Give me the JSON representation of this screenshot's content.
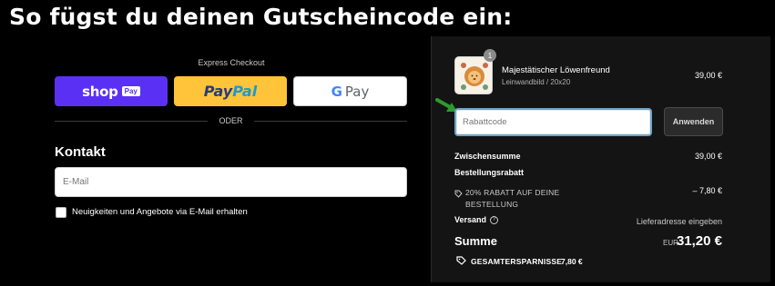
{
  "headline": "So fügst du deinen Gutscheincode ein:",
  "checkout": {
    "express_label": "Express Checkout",
    "shop_pay": {
      "brand": "shop",
      "badge": "Pay"
    },
    "paypal": {
      "part1": "Pay",
      "part2": "Pal"
    },
    "google_pay": {
      "g": "G",
      "label": "Pay"
    },
    "divider": "ODER",
    "contact_heading": "Kontakt",
    "email_placeholder": "E-Mail",
    "newsletter_label": "Neuigkeiten und Angebote via E-Mail erhalten"
  },
  "summary": {
    "product": {
      "name": "Majestätischer Löwenfreund",
      "variant": "Leinwandbild / 20x20",
      "price": "39,00 €",
      "quantity": "1"
    },
    "discount_placeholder": "Rabattcode",
    "apply_label": "Anwenden",
    "subtotal_label": "Zwischensumme",
    "subtotal_value": "39,00 €",
    "order_discount_label": "Bestellungsrabatt",
    "promo_text": "20% RABATT AUF DEINE BESTELLUNG",
    "promo_value": "– 7,80 €",
    "shipping_label": "Versand",
    "shipping_value": "Lieferadresse eingeben",
    "total_label": "Summe",
    "total_currency": "EUR",
    "total_value": "31,20 €",
    "savings_label": "GESAMTERSPARNISSE",
    "savings_value": "7,80 €"
  },
  "colors": {
    "shop_pay": "#5a31f4",
    "paypal": "#ffc439",
    "arrow": "#2e9a2e"
  }
}
